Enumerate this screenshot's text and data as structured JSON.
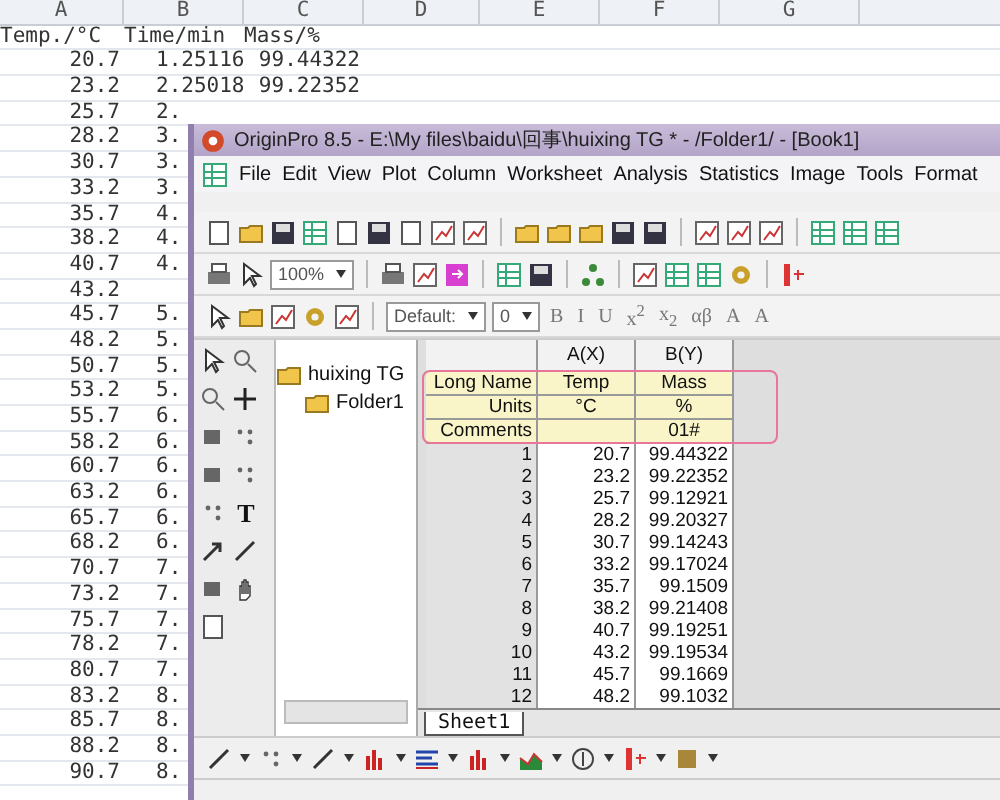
{
  "spreadsheet": {
    "column_letters": [
      "A",
      "B",
      "C",
      "D",
      "E",
      "F",
      "G"
    ],
    "headers": [
      "Temp./°C",
      "Time/min",
      "Mass/%"
    ],
    "rows": [
      {
        "temp": "20.7",
        "time": "1.25116",
        "mass": "99.44322"
      },
      {
        "temp": "23.2",
        "time": "2.25018",
        "mass": "99.22352"
      },
      {
        "temp": "25.7",
        "time": "2."
      },
      {
        "temp": "28.2",
        "time": "3."
      },
      {
        "temp": "30.7",
        "time": "3."
      },
      {
        "temp": "33.2",
        "time": "3."
      },
      {
        "temp": "35.7",
        "time": "4."
      },
      {
        "temp": "38.2",
        "time": "4."
      },
      {
        "temp": "40.7",
        "time": "4."
      },
      {
        "temp": "43.2"
      },
      {
        "temp": "45.7",
        "time": "5."
      },
      {
        "temp": "48.2",
        "time": "5."
      },
      {
        "temp": "50.7",
        "time": "5."
      },
      {
        "temp": "53.2",
        "time": "5."
      },
      {
        "temp": "55.7",
        "time": "6."
      },
      {
        "temp": "58.2",
        "time": "6."
      },
      {
        "temp": "60.7",
        "time": "6."
      },
      {
        "temp": "63.2",
        "time": "6."
      },
      {
        "temp": "65.7",
        "time": "6."
      },
      {
        "temp": "68.2",
        "time": "6."
      },
      {
        "temp": "70.7",
        "time": "7."
      },
      {
        "temp": "73.2",
        "time": "7."
      },
      {
        "temp": "75.7",
        "time": "7."
      },
      {
        "temp": "78.2",
        "time": "7."
      },
      {
        "temp": "80.7",
        "time": "7."
      },
      {
        "temp": "83.2",
        "time": "8."
      },
      {
        "temp": "85.7",
        "time": "8."
      },
      {
        "temp": "88.2",
        "time": "8."
      },
      {
        "temp": "90.7",
        "time": "8."
      }
    ]
  },
  "origin": {
    "title": "OriginPro 8.5 - E:\\My files\\baidu\\回事\\huixing TG * - /Folder1/ - [Book1]",
    "menu": [
      "File",
      "Edit",
      "View",
      "Plot",
      "Column",
      "Worksheet",
      "Analysis",
      "Statistics",
      "Image",
      "Tools",
      "Format"
    ],
    "toolbar": {
      "zoom": "100%",
      "font": "Default:",
      "size": "0",
      "format_buttons": [
        "B",
        "I",
        "U",
        "x$^{2}$",
        "x$_{2}$",
        "αβ",
        "A",
        "A"
      ]
    },
    "text_tool": "T",
    "project": {
      "name": "huixing TG",
      "children": [
        {
          "name": "Folder1"
        }
      ]
    },
    "worksheet": {
      "columns": [
        "A(X)",
        "B(Y)"
      ],
      "label_rows": [
        {
          "label": "Long Name",
          "a": "Temp",
          "b": "Mass"
        },
        {
          "label": "Units",
          "a": "°C",
          "b": "%"
        },
        {
          "label": "Comments",
          "b": "01#"
        }
      ],
      "rows": [
        {
          "index": "1",
          "values": [
            "20.7",
            "99.44322"
          ]
        },
        {
          "index": "2",
          "values": [
            "23.2",
            "99.22352"
          ]
        },
        {
          "index": "3",
          "values": [
            "25.7",
            "99.12921"
          ]
        },
        {
          "index": "4",
          "values": [
            "28.2",
            "99.20327"
          ]
        },
        {
          "index": "5",
          "values": [
            "30.7",
            "99.14243"
          ]
        },
        {
          "index": "6",
          "values": [
            "33.2",
            "99.17024"
          ]
        },
        {
          "index": "7",
          "values": [
            "35.7",
            "99.1509"
          ]
        },
        {
          "index": "8",
          "values": [
            "38.2",
            "99.21408"
          ]
        },
        {
          "index": "9",
          "values": [
            "40.7",
            "99.19251"
          ]
        },
        {
          "index": "10",
          "values": [
            "43.2",
            "99.19534"
          ]
        },
        {
          "index": "11",
          "values": [
            "45.7",
            "99.1669"
          ]
        },
        {
          "index": "12",
          "values": [
            "48.2",
            "99.1032"
          ]
        }
      ],
      "sheets": [
        {
          "label": "Sheet1",
          "selected": true
        }
      ]
    }
  }
}
